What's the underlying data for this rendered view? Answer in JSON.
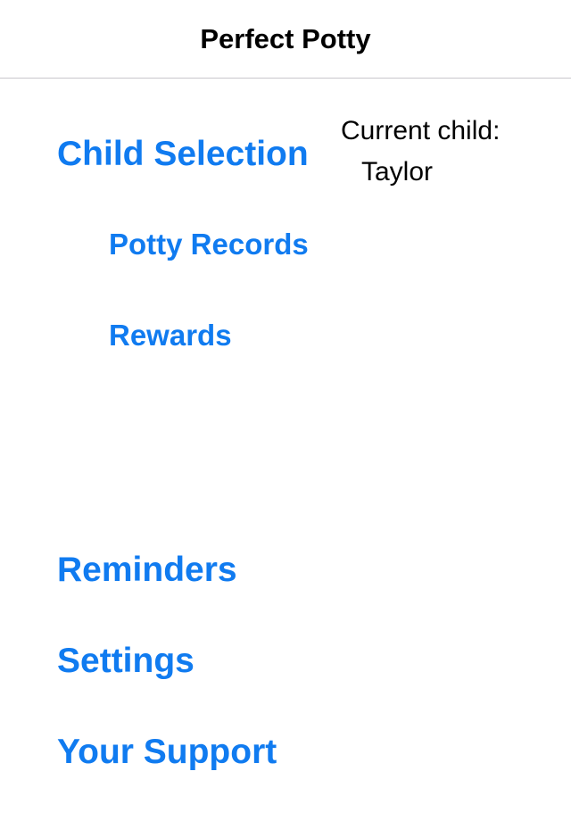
{
  "header": {
    "title": "Perfect Potty"
  },
  "menu": {
    "child_selection": "Child Selection",
    "potty_records": "Potty Records",
    "rewards": "Rewards",
    "reminders": "Reminders",
    "settings": "Settings",
    "your_support": "Your Support"
  },
  "current_child": {
    "label": "Current child:",
    "name": "Taylor"
  },
  "colors": {
    "link": "#107bf0",
    "text": "#000000",
    "divider": "#c8c7cc",
    "background": "#ffffff"
  }
}
